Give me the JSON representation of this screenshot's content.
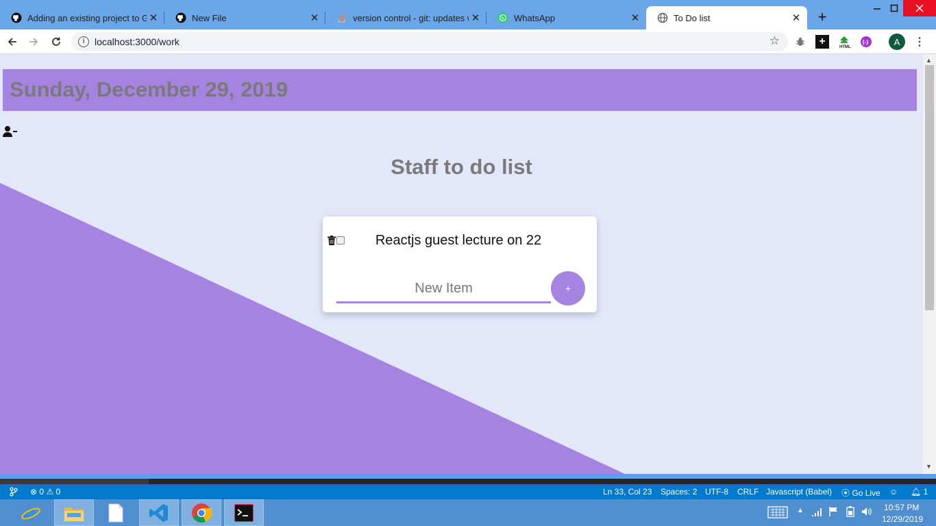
{
  "browser": {
    "tabs": [
      {
        "title": "Adding an existing project to Gi",
        "icon": "github-icon",
        "active": false
      },
      {
        "title": "New File",
        "icon": "github-icon",
        "active": false
      },
      {
        "title": "version control - git: updates we",
        "icon": "stackoverflow-icon",
        "active": false
      },
      {
        "title": "WhatsApp",
        "icon": "whatsapp-icon",
        "active": false
      },
      {
        "title": "To Do list",
        "icon": "globe-icon",
        "active": true
      }
    ],
    "new_tab_label": "+",
    "url": "localhost:3000/work",
    "profile_initial": "A"
  },
  "page": {
    "date_heading": "Sunday, December 29, 2019",
    "list_title": "Staff to do list",
    "items": [
      {
        "text": "Reactjs guest lecture on 22",
        "checked": false
      }
    ],
    "new_item_placeholder": "New Item",
    "add_button_label": "+",
    "colors": {
      "accent": "#a683e1",
      "background": "#e3e7fa",
      "heading_text": "#7a7a7a"
    }
  },
  "editor_status": {
    "errors": "0",
    "warnings": "0",
    "cursor": "Ln 33, Col 23",
    "spaces": "Spaces: 2",
    "encoding": "UTF-8",
    "line_ending": "CRLF",
    "language": "Javascript (Babel)",
    "go_live": "Go Live",
    "notifications": "1"
  },
  "taskbar": {
    "apps": [
      "internet-explorer",
      "file-explorer",
      "notepad",
      "vscode",
      "chrome",
      "terminal"
    ],
    "active_app": "chrome",
    "time": "10:57 PM",
    "date": "12/29/2019"
  }
}
